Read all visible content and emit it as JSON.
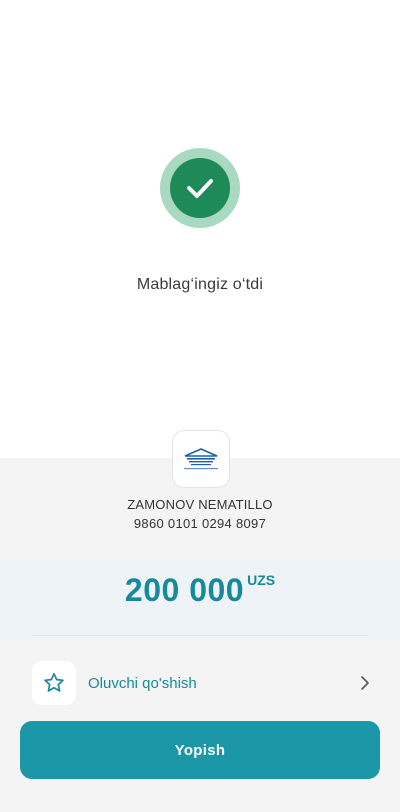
{
  "status": {
    "message": "Mablag‘ingiz o‘tdi",
    "icon": "check-icon",
    "color": "#1e8a57"
  },
  "recipient": {
    "bank_logo_icon": "bank-logo-icon",
    "name": "ZAMONOV NEMATILLO",
    "card_number": "9860 0101 0294 8097"
  },
  "amount": {
    "value": "200 000",
    "currency": "UZS",
    "color": "#168a9a"
  },
  "actions": {
    "add_recipient_label": "Oluvchi qo'shish",
    "add_recipient_icon": "star-icon",
    "chevron_icon": "chevron-right-icon",
    "close_label": "Yopish",
    "close_color": "#1b97a8"
  }
}
